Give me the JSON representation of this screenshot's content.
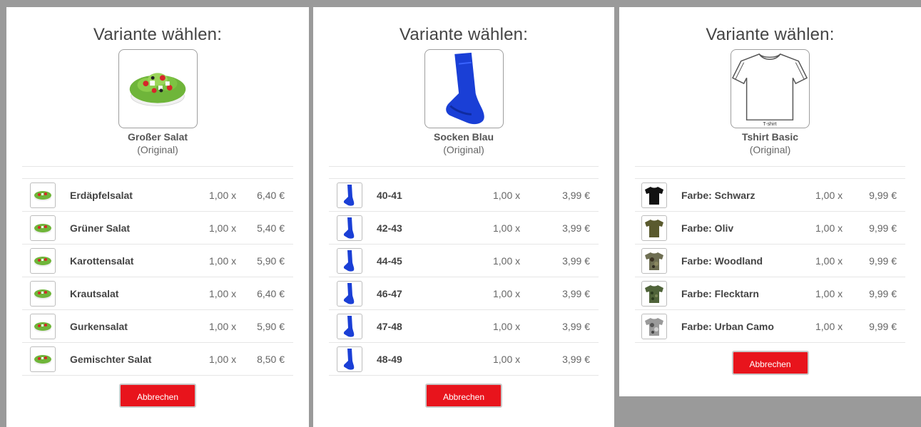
{
  "panels": [
    {
      "title": "Variante wählen:",
      "product_name": "Großer Salat",
      "product_sub": "(Original)",
      "hero_icon": "salad-image",
      "variants": [
        {
          "name": "Erdäpfelsalat",
          "qty": "1,00 x",
          "price": "6,40 €"
        },
        {
          "name": "Grüner Salat",
          "qty": "1,00 x",
          "price": "5,40 €"
        },
        {
          "name": "Karottensalat",
          "qty": "1,00 x",
          "price": "5,90 €"
        },
        {
          "name": "Krautsalat",
          "qty": "1,00 x",
          "price": "6,40 €"
        },
        {
          "name": "Gurkensalat",
          "qty": "1,00 x",
          "price": "5,90 €"
        },
        {
          "name": "Gemischter Salat",
          "qty": "1,00 x",
          "price": "8,50 €"
        }
      ],
      "cancel_label": "Abbrechen"
    },
    {
      "title": "Variante wählen:",
      "product_name": "Socken Blau",
      "product_sub": "(Original)",
      "hero_icon": "sock-image",
      "variants": [
        {
          "name": "40-41",
          "qty": "1,00 x",
          "price": "3,99 €"
        },
        {
          "name": "42-43",
          "qty": "1,00 x",
          "price": "3,99 €"
        },
        {
          "name": "44-45",
          "qty": "1,00 x",
          "price": "3,99 €"
        },
        {
          "name": "46-47",
          "qty": "1,00 x",
          "price": "3,99 €"
        },
        {
          "name": "47-48",
          "qty": "1,00 x",
          "price": "3,99 €"
        },
        {
          "name": "48-49",
          "qty": "1,00 x",
          "price": "3,99 €"
        }
      ],
      "cancel_label": "Abbrechen"
    },
    {
      "title": "Variante wählen:",
      "product_name": "Tshirt Basic",
      "product_sub": "(Original)",
      "hero_icon": "tshirt-outline-image",
      "hero_caption": "T-shirt",
      "variants": [
        {
          "name": "Farbe: Schwarz",
          "qty": "1,00 x",
          "price": "9,99 €",
          "color": "#111111"
        },
        {
          "name": "Farbe: Oliv",
          "qty": "1,00 x",
          "price": "9,99 €",
          "color": "#5a5a2e"
        },
        {
          "name": "Farbe: Woodland",
          "qty": "1,00 x",
          "price": "9,99 €",
          "color": "#6e6e52"
        },
        {
          "name": "Farbe: Flecktarn",
          "qty": "1,00 x",
          "price": "9,99 €",
          "color": "#4f6339"
        },
        {
          "name": "Farbe: Urban Camo",
          "qty": "1,00 x",
          "price": "9,99 €",
          "color": "#9a9a9a"
        }
      ],
      "cancel_label": "Abbrechen"
    }
  ],
  "colors": {
    "cancel_button": "#e8141c",
    "sock_blue": "#1a3fd6",
    "background": "#9a9a9a"
  }
}
